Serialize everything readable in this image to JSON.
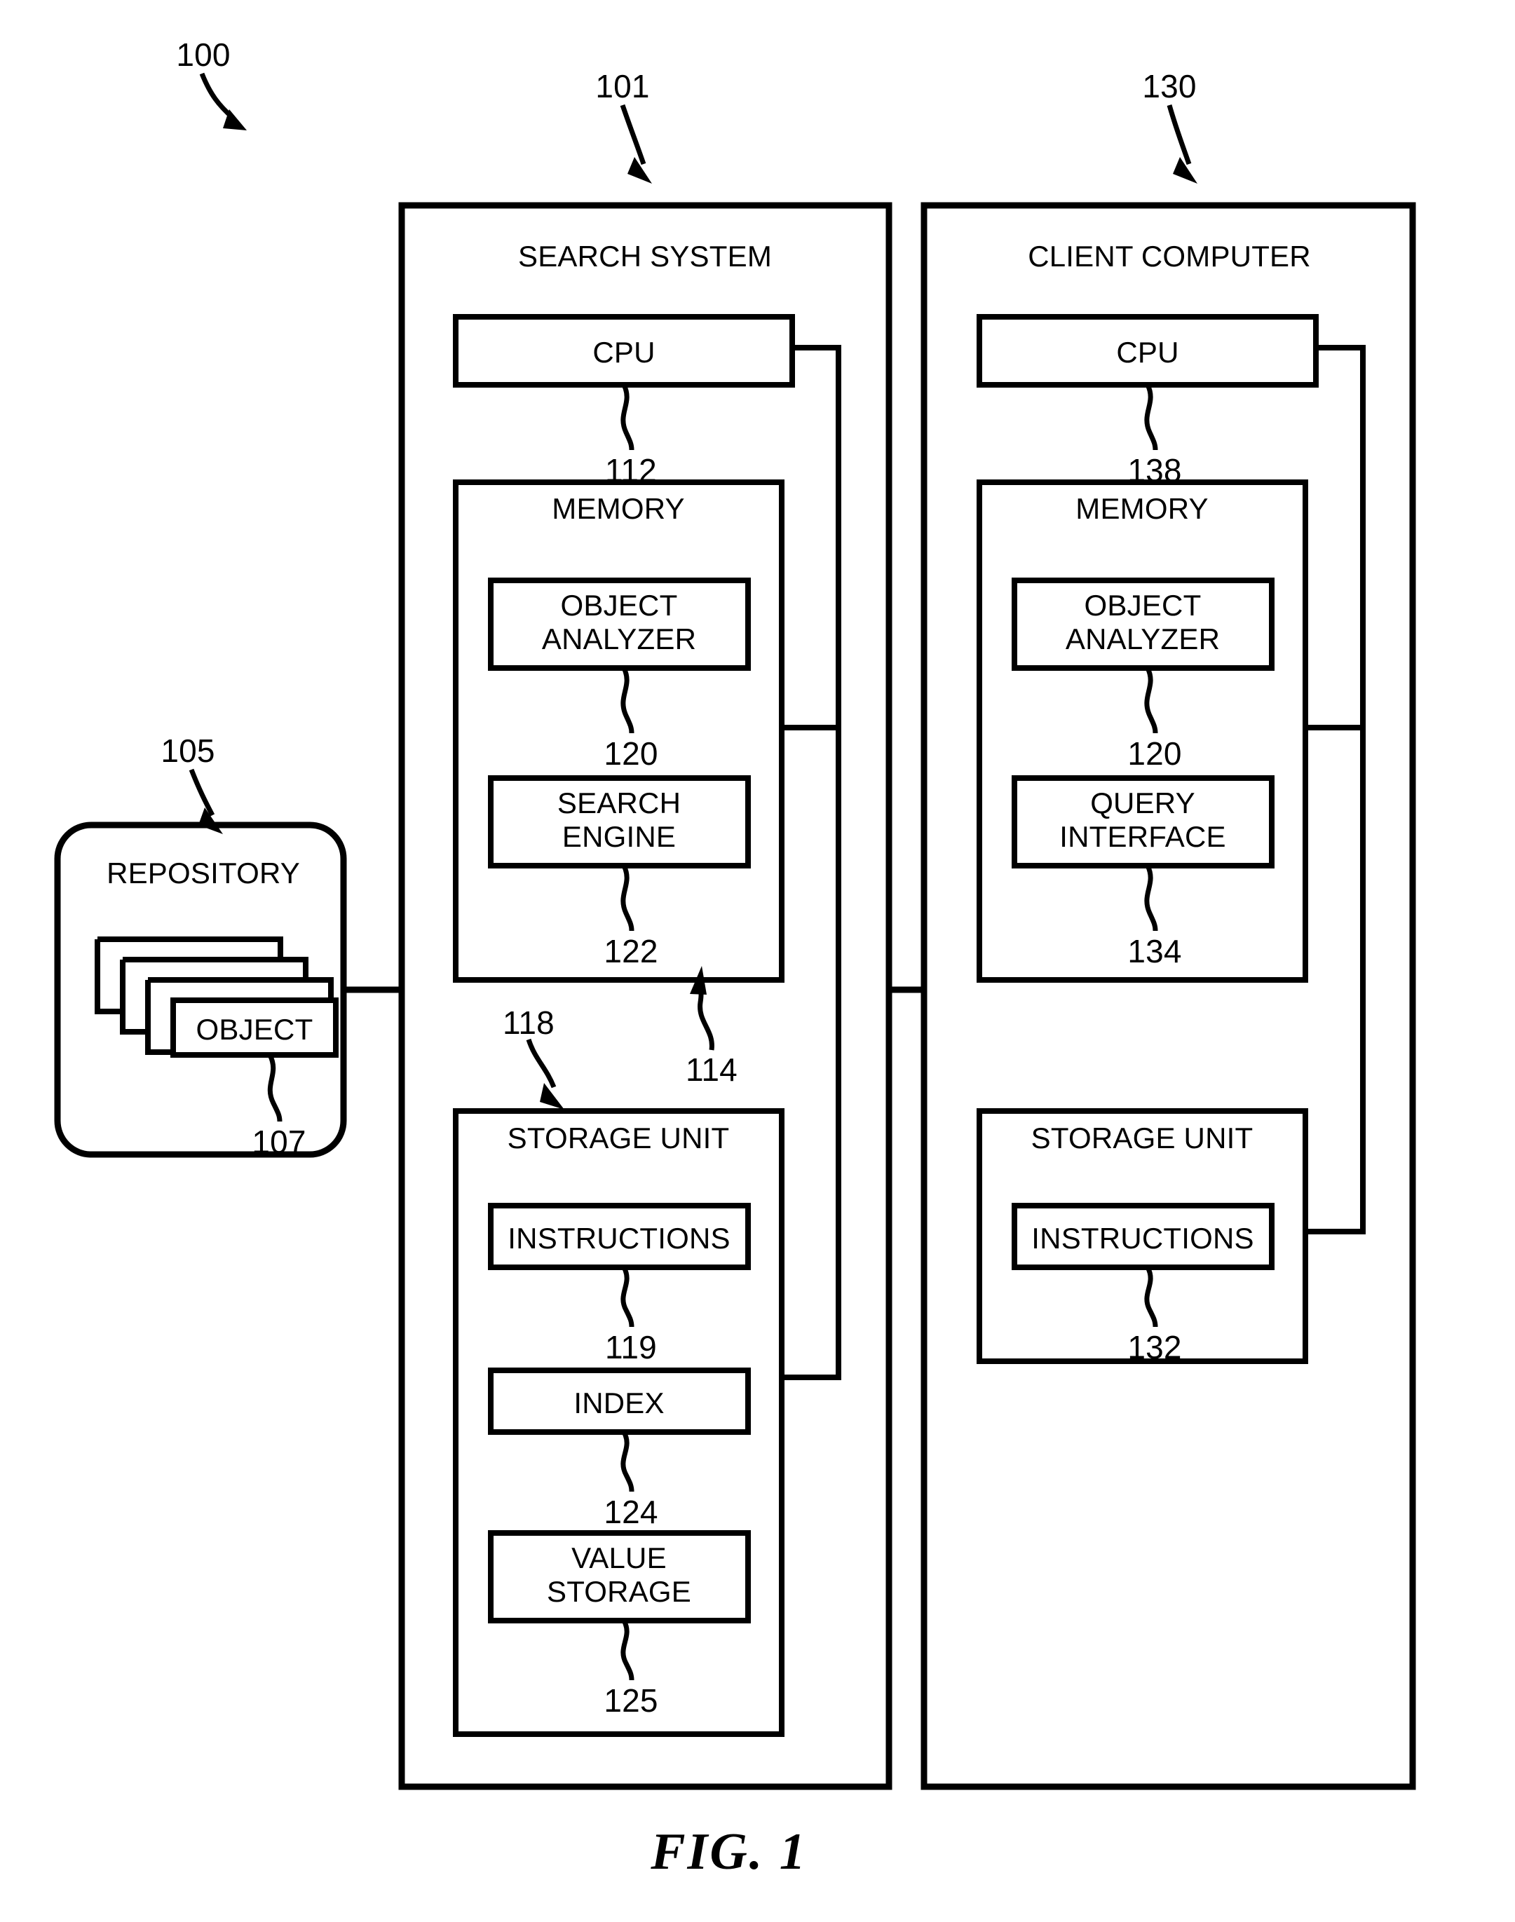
{
  "figure": {
    "caption": "FIG. 1",
    "system_ref": "100"
  },
  "repository": {
    "ref": "105",
    "title": "REPOSITORY",
    "object": {
      "label": "OBJECT",
      "ref": "107"
    },
    "stacked_sheets": 3
  },
  "search_system": {
    "ref": "101",
    "title": "SEARCH SYSTEM",
    "bus_ref": "114",
    "cpu": {
      "label": "CPU",
      "ref": "112"
    },
    "memory": {
      "title": "MEMORY",
      "modules": [
        {
          "label": "OBJECT\nANALYZER",
          "ref": "120"
        },
        {
          "label": "SEARCH\nENGINE",
          "ref": "122"
        }
      ]
    },
    "storage_unit": {
      "title": "STORAGE UNIT",
      "ref": "118",
      "modules": [
        {
          "label": "INSTRUCTIONS",
          "ref": "119"
        },
        {
          "label": "INDEX",
          "ref": "124"
        },
        {
          "label": "VALUE\nSTORAGE",
          "ref": "125"
        }
      ]
    }
  },
  "client_computer": {
    "ref": "130",
    "title": "CLIENT COMPUTER",
    "cpu": {
      "label": "CPU",
      "ref": "138"
    },
    "memory": {
      "title": "MEMORY",
      "modules": [
        {
          "label": "OBJECT\nANALYZER",
          "ref": "120"
        },
        {
          "label": "QUERY\nINTERFACE",
          "ref": "134"
        }
      ]
    },
    "storage_unit": {
      "title": "STORAGE UNIT",
      "modules": [
        {
          "label": "INSTRUCTIONS",
          "ref": "132"
        }
      ]
    }
  },
  "colors": {
    "stroke": "#000000",
    "background": "#ffffff"
  }
}
